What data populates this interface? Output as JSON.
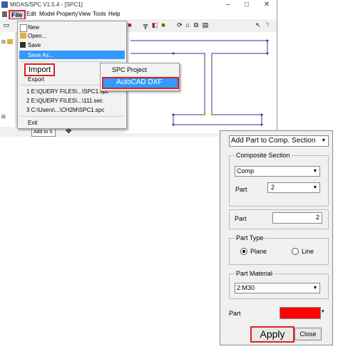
{
  "window": {
    "title": "MIDAS/SPC V1.5.4 - [SPC1]",
    "minimize": "–",
    "maximize": "□",
    "close": "✕"
  },
  "menubar": [
    "File",
    "Edit",
    "Model",
    "Property",
    "View",
    "Tools",
    "Help"
  ],
  "file_menu": {
    "new": "New",
    "open": "Open...",
    "save": "Save",
    "save_as": "Save As...",
    "import": "Import",
    "export": "Export",
    "recent": [
      "1 E:\\QUERY FILES\\...\\SPC1.spc",
      "2 E:\\QUERY FILES\\...\\111.sec",
      "3 C:\\Users\\...\\CH2M\\SPC1.spc"
    ],
    "exit": "Exit"
  },
  "import_submenu": {
    "spc_project": "SPC Project",
    "autocad_dxf": "AutoCAD DXF"
  },
  "statusbar": {
    "add_to_s": "Add to S"
  },
  "panel": {
    "mode": "Add Part to Comp. Section",
    "composite_section": {
      "title": "Composite Section",
      "value": "Comp",
      "part_label": "Part",
      "part_value": "2"
    },
    "part": {
      "label": "Part",
      "value": "2"
    },
    "part_type": {
      "title": "Part Type",
      "plane": "Plane",
      "line": "Line",
      "selected": "Plane"
    },
    "part_material": {
      "title": "Part Material",
      "value": "2:M30"
    },
    "part_color": {
      "label": "Part",
      "color": "#ff0000"
    },
    "apply": "Apply",
    "close": "Close"
  },
  "colors": {
    "highlight": "#e02020",
    "selection": "#3399ff",
    "section_line": "#333399"
  }
}
